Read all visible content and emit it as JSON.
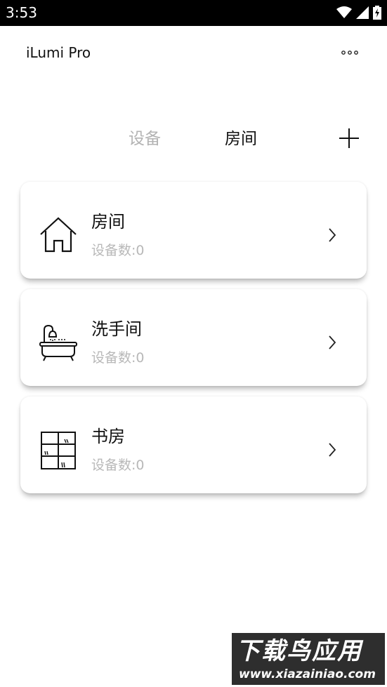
{
  "status_bar": {
    "time": "3:53"
  },
  "header": {
    "app_title": "iLumi Pro"
  },
  "tabs": [
    {
      "label": "设备",
      "active": false
    },
    {
      "label": "房间",
      "active": true
    }
  ],
  "rooms": [
    {
      "name": "房间",
      "count_label": "设备数:",
      "count": "0",
      "icon": "house-icon"
    },
    {
      "name": "洗手间",
      "count_label": "设备数:",
      "count": "0",
      "icon": "bathtub-icon"
    },
    {
      "name": "书房",
      "count_label": "设备数:",
      "count": "0",
      "icon": "bookshelf-icon"
    }
  ],
  "watermark": {
    "main": "下载鸟应用",
    "sub": "www.xiazainiao.com"
  },
  "colors": {
    "active_tab": "#111111",
    "inactive_tab": "#b3b3b3",
    "secondary_text": "#b8b8b8",
    "status_bar": "#000000"
  }
}
